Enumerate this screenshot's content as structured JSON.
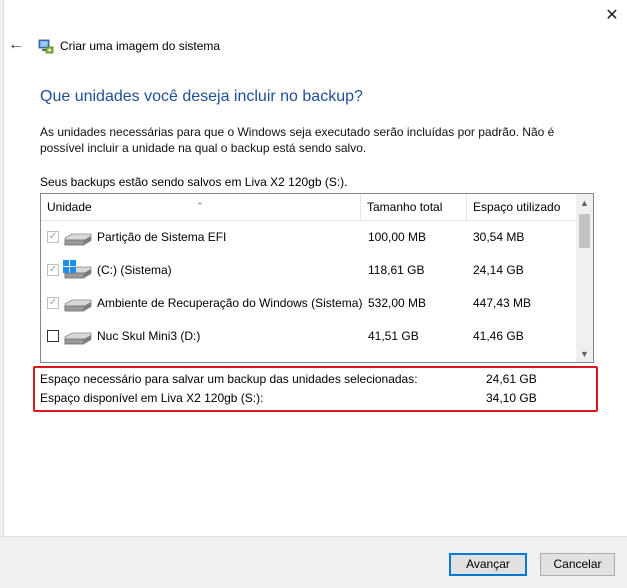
{
  "window": {
    "title": "Criar uma imagem do sistema",
    "close_glyph": "✕",
    "back_glyph": "←"
  },
  "main": {
    "heading": "Que unidades você deseja incluir no backup?",
    "description": "As unidades necessárias para que o Windows seja executado serão incluídas por padrão. Não é possível incluir a unidade na qual o backup está sendo salvo.",
    "saved_to": "Seus backups estão sendo salvos em Liva X2 120gb (S:)."
  },
  "list": {
    "columns": [
      "Unidade",
      "Tamanho total",
      "Espaço utilizado"
    ],
    "sort_glyph": "⌃",
    "rows": [
      {
        "name": "Partição de Sistema EFI",
        "total": "100,00 MB",
        "used": "30,54 MB",
        "checked": true,
        "disabled": true,
        "icon": "drive-icon"
      },
      {
        "name": "(C:) (Sistema)",
        "total": "118,61 GB",
        "used": "24,14 GB",
        "checked": true,
        "disabled": true,
        "icon": "windows-drive-icon"
      },
      {
        "name": "Ambiente de Recuperação do Windows (Sistema)",
        "total": "532,00 MB",
        "used": "447,43 MB",
        "checked": true,
        "disabled": true,
        "icon": "drive-icon"
      },
      {
        "name": "Nuc Skul Mini3 (D:)",
        "total": "41,51 GB",
        "used": "41,46 GB",
        "checked": false,
        "disabled": false,
        "icon": "drive-icon"
      }
    ],
    "check_glyph": "✓",
    "scroll_up": "▲",
    "scroll_down": "▼"
  },
  "space": {
    "required_label": "Espaço necessário para salvar um backup das unidades selecionadas:",
    "required_value": "24,61 GB",
    "available_label": "Espaço disponível em Liva X2 120gb (S:):",
    "available_value": "34,10 GB"
  },
  "buttons": {
    "next": "Avançar",
    "cancel": "Cancelar"
  },
  "colors": {
    "heading": "#1f4e99",
    "highlight_border": "#e0141e",
    "primary_border": "#0078d7"
  }
}
